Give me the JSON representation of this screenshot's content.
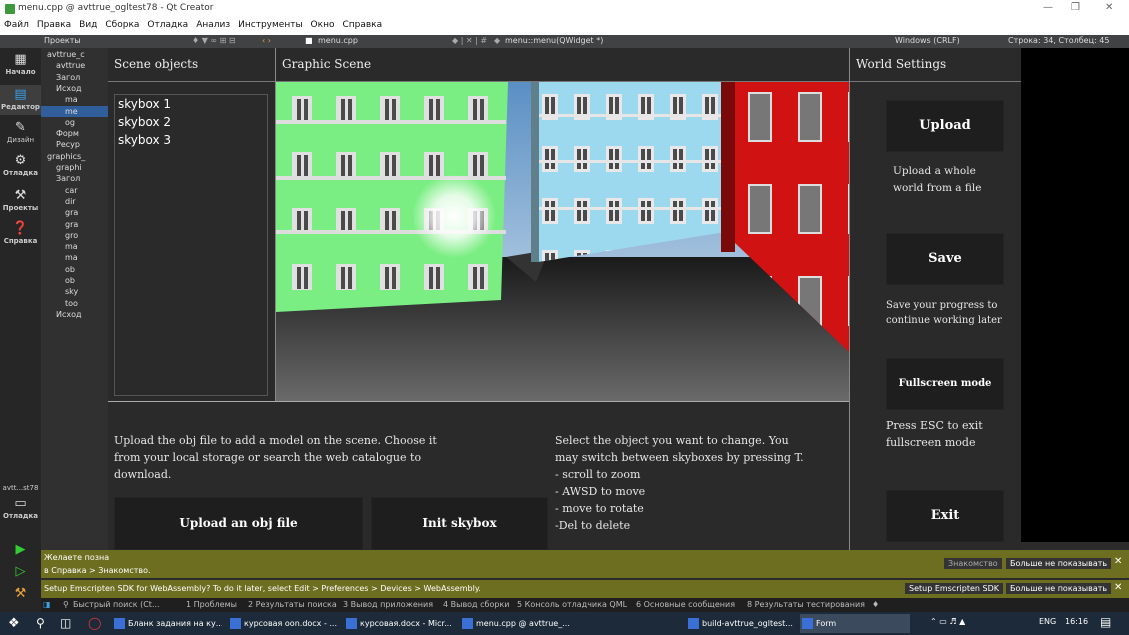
{
  "window": {
    "title": "menu.cpp @ avttrue_ogltest78 - Qt Creator"
  },
  "menubar": [
    "Файл",
    "Правка",
    "Вид",
    "Сборка",
    "Отладка",
    "Анализ",
    "Инструменты",
    "Окно",
    "Справка"
  ],
  "toolbar": {
    "projects_label": "Проекты",
    "file_tab": "menu.cpp",
    "function_label": "menu::menu(QWidget *)",
    "line_ending": "Windows (CRLF)",
    "cursor_position": "Строка: 34, Столбец: 45"
  },
  "modes": [
    {
      "label": "Начало",
      "icon": "grid-icon"
    },
    {
      "label": "Редактор",
      "icon": "editor-icon"
    },
    {
      "label": "Дизайн",
      "icon": "design-icon"
    },
    {
      "label": "Отладка",
      "icon": "debug-icon"
    },
    {
      "label": "Проекты",
      "icon": "wrench-icon"
    },
    {
      "label": "Справка",
      "icon": "help-icon"
    }
  ],
  "kit": {
    "label": "avtt...st78",
    "mode": "Отладка"
  },
  "project_tree": [
    "avttrue_c",
    "avttrue",
    "Загол",
    "Исход",
    "ma",
    "me",
    "og",
    "Форм",
    "Ресур",
    "graphics_",
    "graphi",
    "Загол",
    "car",
    "dir",
    "gra",
    "gra",
    "gro",
    "ma",
    "ma",
    "ob",
    "ob",
    "sky",
    "too",
    "Исход"
  ],
  "app": {
    "scene_objects_title": "Scene objects",
    "graphic_scene_title": "Graphic Scene",
    "world_settings_title": "World Settings",
    "scene_objects": [
      "skybox 1",
      "skybox 2",
      "skybox 3"
    ],
    "upload_world_button": "Upload",
    "upload_world_desc": "Upload a whole world from a file",
    "save_button": "Save",
    "save_desc": "Save your progress to continue working later",
    "fullscreen_button": "Fullscreen mode",
    "fullscreen_desc": "Press ESC to exit fullscreen mode",
    "exit_button": "Exit",
    "upload_obj_desc": "Upload the obj file to add a model on the scene. Choose it from your local storage or search the web catalogue to download.",
    "upload_obj_button": "Upload an obj file",
    "init_skybox_button": "Init skybox",
    "help_lines": [
      "Select the object you want to change. You",
      "may switch between skyboxes by pressing T.",
      "- scroll to zoom",
      "- AWSD to move",
      "- move to rotate",
      "-Del to delete"
    ]
  },
  "notifications": [
    {
      "text1": "Желаете позна",
      "text2": "в Справка > Знакомство.",
      "btn1": "Знакомство",
      "btn2": "Больше не показывать"
    },
    {
      "text1": "Setup Emscripten SDK for WebAssembly? To do it later, select Edit > Preferences > Devices > WebAssembly.",
      "btn1": "Setup Emscripten SDK",
      "btn2": "Больше не показывать"
    }
  ],
  "output_tabs": {
    "search": "Быстрый поиск (Ct...",
    "tabs": [
      "1 Проблемы",
      "2 Результаты поиска",
      "3 Вывод приложения",
      "4 Вывод сборки",
      "5 Консоль отладчика QML",
      "6 Основные сообщения",
      "8 Результаты тестирования"
    ]
  },
  "taskbar": {
    "tasks": [
      "Бланк задания на ку...",
      "курсовая oon.docx - ...",
      "курсовая.docx - Micr...",
      "menu.cpp @ avttrue_...",
      "build-avttrue_ogltest...",
      "Form"
    ],
    "lang": "ENG",
    "time": "16:16"
  },
  "colors": {
    "accent_green": "#7aee82",
    "building_blue": "#9cd8ee",
    "building_red": "#d11212",
    "app_bg": "#2a2a2a",
    "button_bg": "#1e1e1e",
    "notify_bg": "#6e6e20"
  }
}
